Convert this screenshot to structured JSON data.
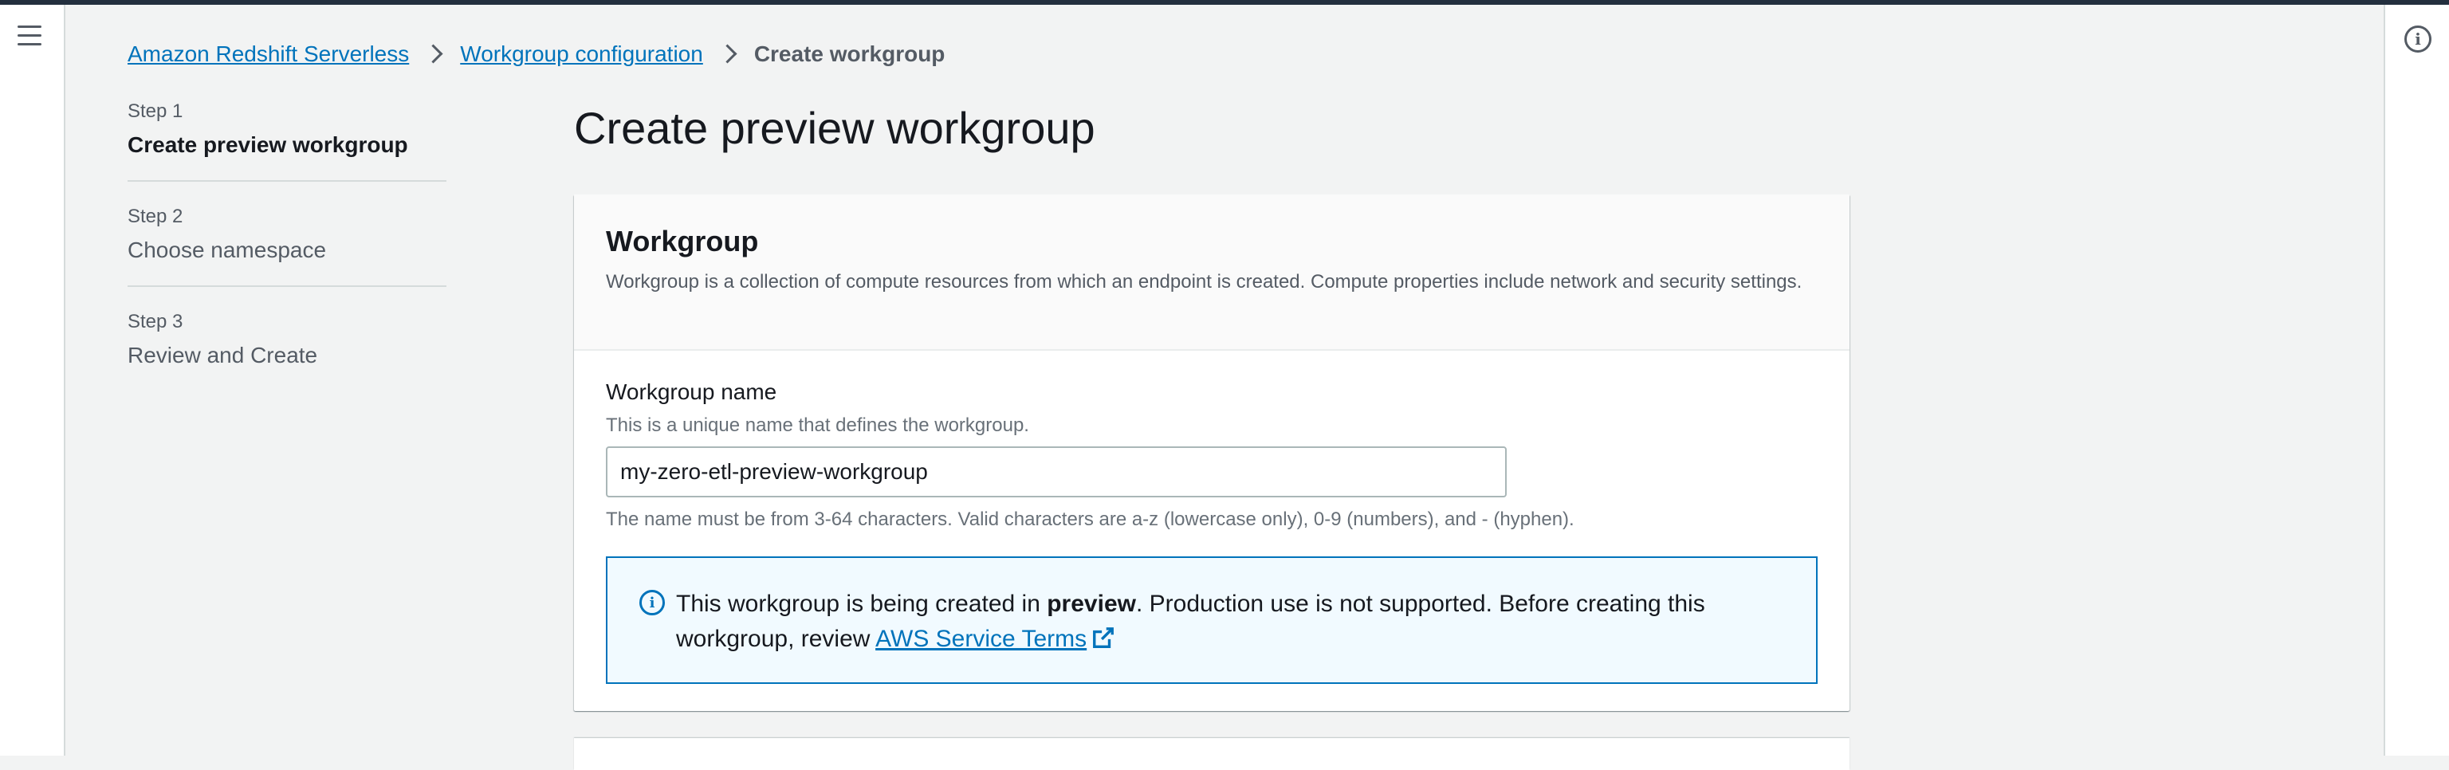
{
  "breadcrumb": {
    "items": [
      "Amazon Redshift Serverless",
      "Workgroup configuration"
    ],
    "current": "Create workgroup"
  },
  "steps": [
    {
      "number": "Step 1",
      "title": "Create preview workgroup"
    },
    {
      "number": "Step 2",
      "title": "Choose namespace"
    },
    {
      "number": "Step 3",
      "title": "Review and Create"
    }
  ],
  "page": {
    "title": "Create preview workgroup"
  },
  "workgroup": {
    "title": "Workgroup",
    "description": "Workgroup is a collection of compute resources from which an endpoint is created. Compute properties include network and security settings.",
    "name_label": "Workgroup name",
    "name_description": "This is a unique name that defines the workgroup.",
    "name_value": "my-zero-etl-preview-workgroup",
    "name_hint": "The name must be from 3-64 characters. Valid characters are a-z (lowercase only), 0-9 (numbers), and - (hyphen)."
  },
  "alert": {
    "text_before": "This workgroup is being created in ",
    "bold": "preview",
    "text_after": ". Production use is not supported. Before creating this workgroup, review ",
    "link": "AWS Service Terms"
  },
  "icons": {
    "menu": "hamburger-menu-icon",
    "info": "info-icon",
    "external": "external-link-icon"
  },
  "colors": {
    "link": "#0073bb",
    "alert_bg": "#f1faff",
    "top_bar": "#232f3e"
  }
}
